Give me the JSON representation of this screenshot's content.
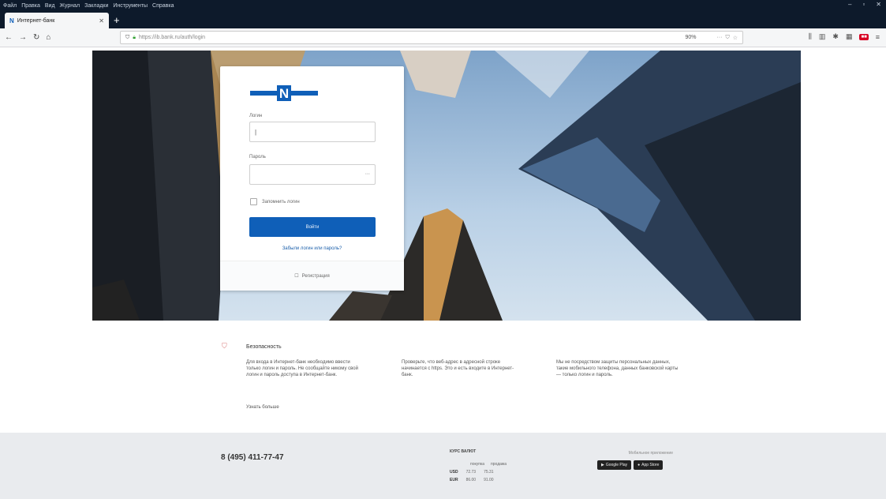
{
  "browser": {
    "menu": [
      "Файл",
      "Правка",
      "Вид",
      "Журнал",
      "Закладки",
      "Инструменты",
      "Справка"
    ],
    "tab_title": "Интернет-банк",
    "url": "https://ib.bank.ru/auth/login",
    "zoom": "90%"
  },
  "login": {
    "login_label": "Логин",
    "password_label": "Пароль",
    "remember_label": "Запомнить логин",
    "submit_label": "Войти",
    "forgot_label": "Забыли логин или пароль?",
    "register_label": "Регистрация"
  },
  "security": {
    "title": "Безопасность",
    "col1": "Для входа в Интернет-банк необходимо ввести только логин и пароль. Не сообщайте никому свой логин и пароль доступа в Интернет-банк.",
    "col2": "Проверьте, что веб-адрес в адресной строке начинается с https. Это и есть входите в Интернет-банк.",
    "col3": "Мы не посредством защиты персональных данных, такие мобильного телефона, данных банковской карты — только логин и пароль.",
    "more": "Узнать больше"
  },
  "footer": {
    "phone": "8 (495) 411-77-47",
    "rates_title": "КУРС ВАЛЮТ",
    "rates_head": [
      "покупка",
      "продажа"
    ],
    "rates": [
      {
        "cur": "USD",
        "buy": "72.73",
        "sell": "75.31"
      },
      {
        "cur": "EUR",
        "buy": "86.00",
        "sell": "91.00"
      }
    ],
    "apps_title": "Мобильное приложение",
    "app1": "Google Play",
    "app2": "App Store"
  }
}
